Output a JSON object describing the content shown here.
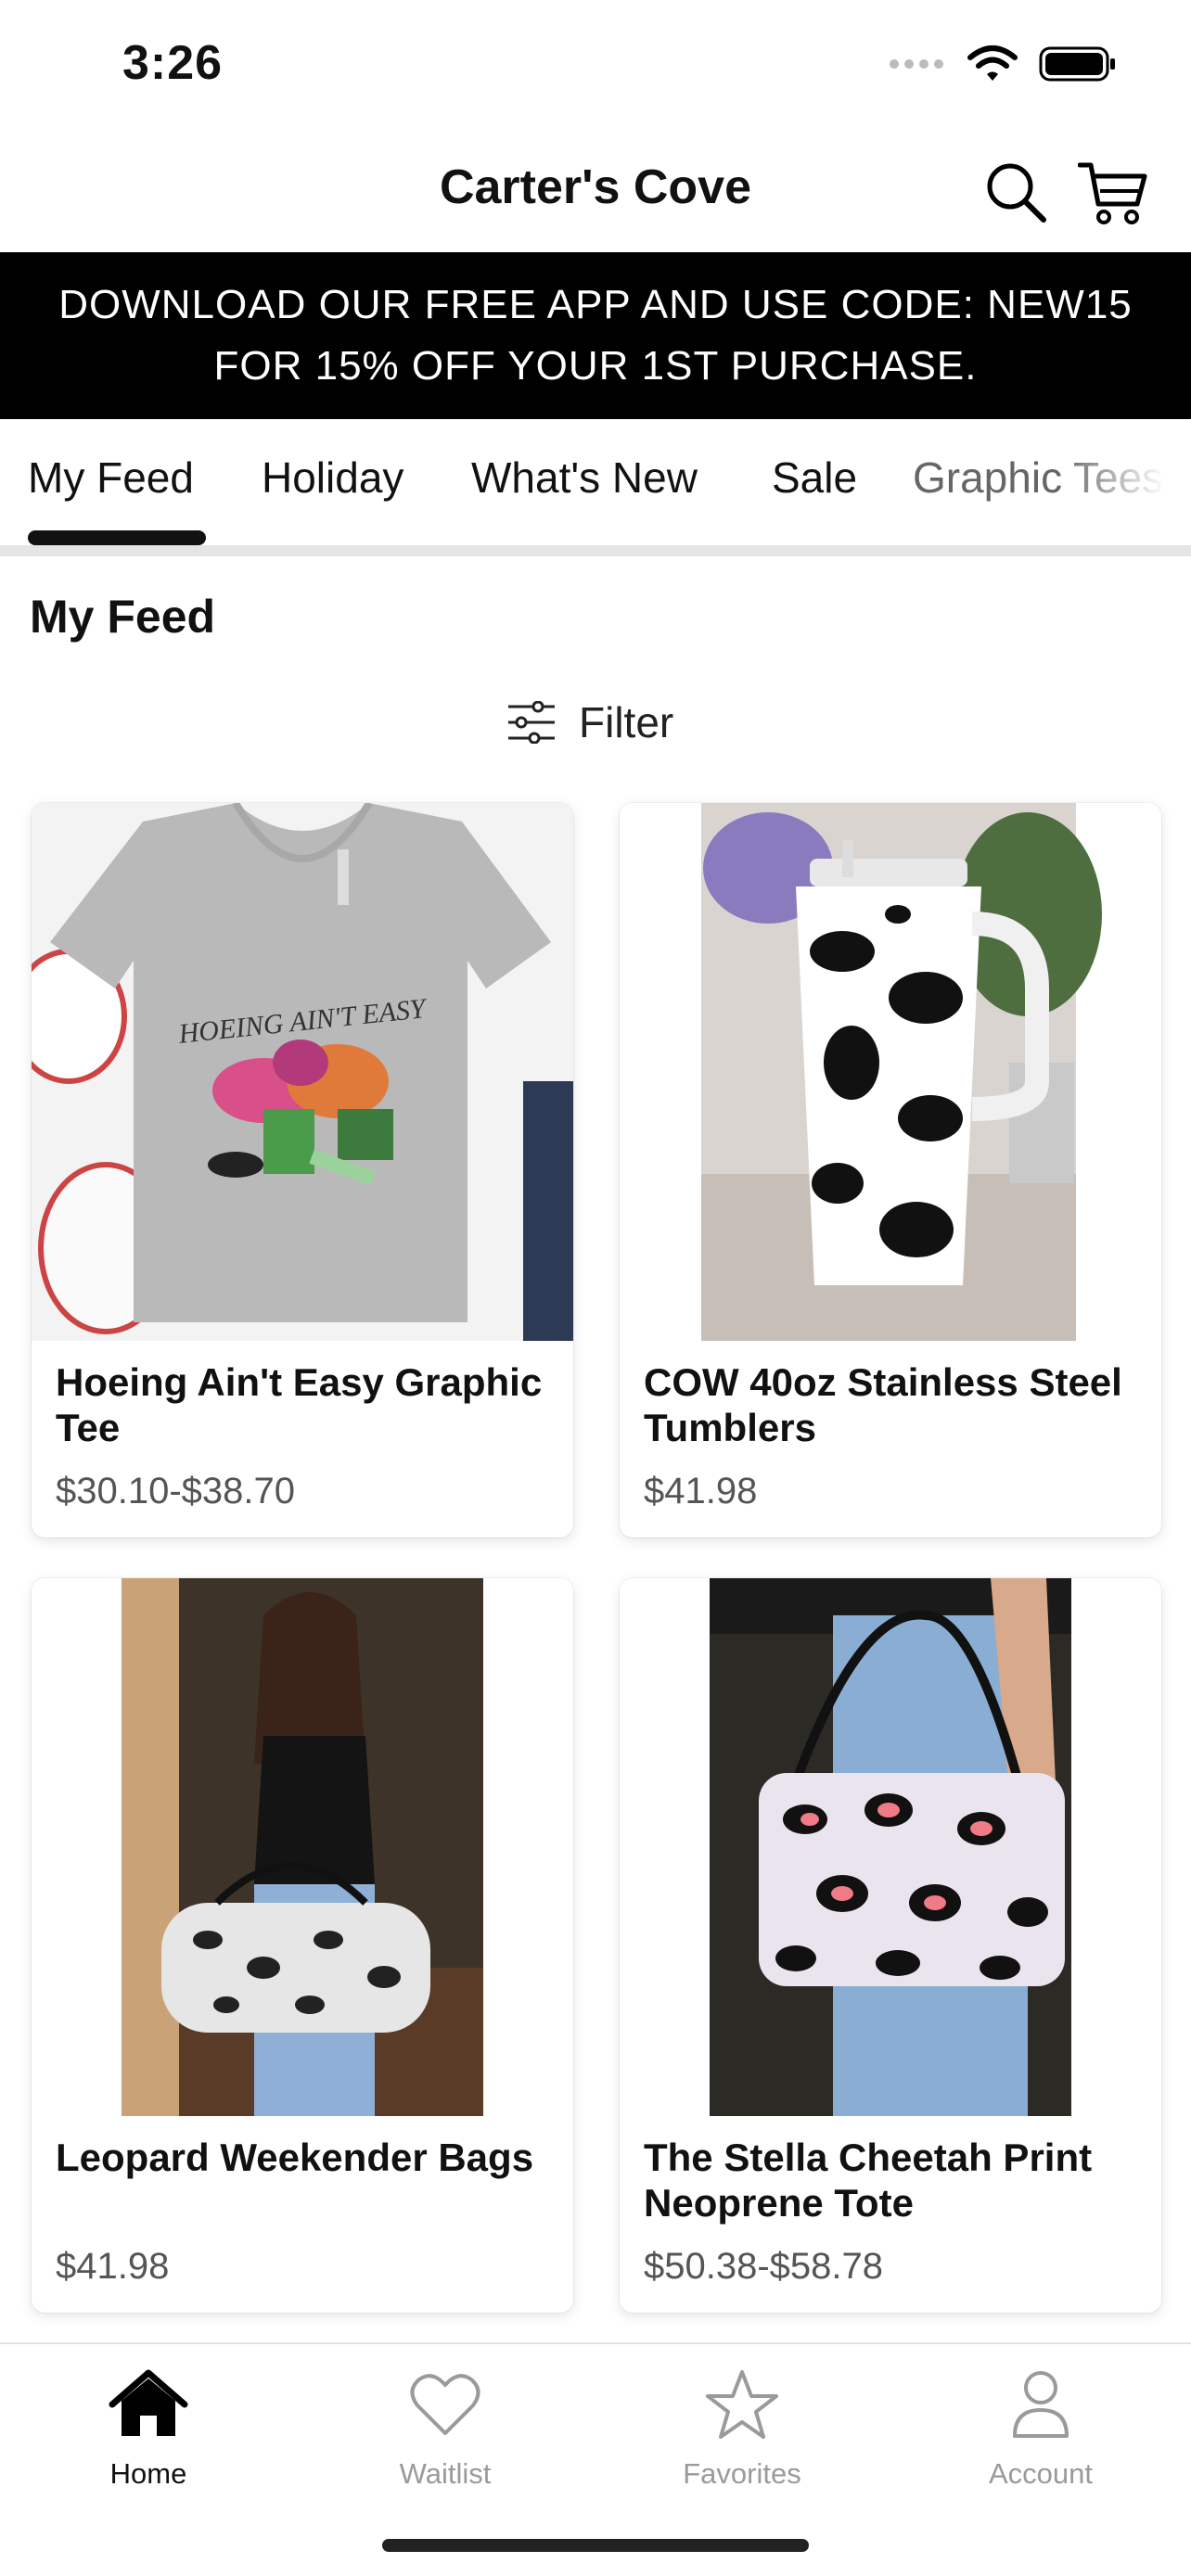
{
  "status_bar": {
    "time": "3:26"
  },
  "header": {
    "title": "Carter's Cove"
  },
  "promo": {
    "line1": "DOWNLOAD OUR FREE APP AND USE CODE: NEW15",
    "line2": "FOR 15% OFF YOUR 1ST PURCHASE."
  },
  "tabs": [
    {
      "label": "My Feed",
      "active": true
    },
    {
      "label": "Holiday"
    },
    {
      "label": "What's New"
    },
    {
      "label": "Sale"
    },
    {
      "label": "Graphic Tees"
    }
  ],
  "feed": {
    "title": "My Feed",
    "filter_label": "Filter",
    "products": [
      {
        "name": "Hoeing Ain't Easy Graphic Tee",
        "price": "$30.10-$38.70",
        "print": "HOEING AIN'T EASY"
      },
      {
        "name": "COW 40oz Stainless Steel Tumblers",
        "price": "$41.98"
      },
      {
        "name": "Leopard Weekender Bags",
        "price": "$41.98"
      },
      {
        "name": "The Stella Cheetah Print Neoprene Tote",
        "price": "$50.38-$58.78"
      }
    ]
  },
  "bottom_nav": [
    {
      "label": "Home",
      "icon": "home-icon",
      "active": true
    },
    {
      "label": "Waitlist",
      "icon": "heart-icon"
    },
    {
      "label": "Favorites",
      "icon": "star-icon"
    },
    {
      "label": "Account",
      "icon": "person-icon"
    }
  ],
  "colors": {
    "banner": "#000000",
    "text": "#111111",
    "muted": "#9a9a9a"
  }
}
